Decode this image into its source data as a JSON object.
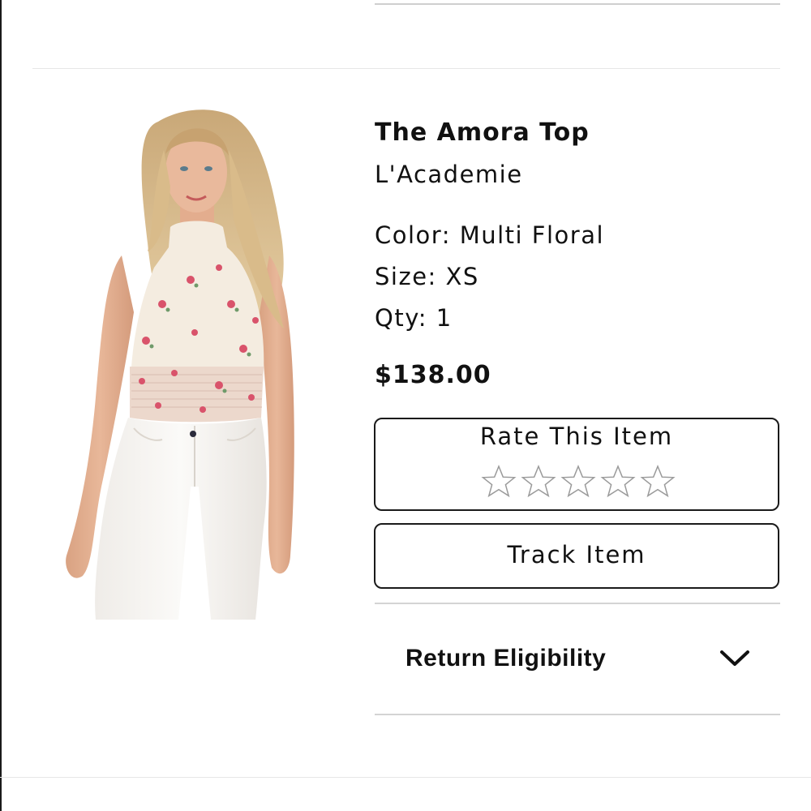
{
  "product": {
    "name": "The Amora Top",
    "brand": "L'Academie",
    "color_label": "Color:",
    "color_value": "Multi Floral",
    "size_label": "Size:",
    "size_value": "XS",
    "qty_label": "Qty:",
    "qty_value": "1",
    "price": "$138.00",
    "image_icon": "product-photo"
  },
  "rating": {
    "label": "Rate This Item",
    "max_stars": 5,
    "current": 0,
    "star_icon": "star-outline-icon"
  },
  "track": {
    "label": "Track Item"
  },
  "return_eligibility": {
    "label": "Return Eligibility",
    "icon": "chevron-down-icon",
    "expanded": false
  },
  "colors": {
    "text": "#111111",
    "border": "#1a1a1a",
    "divider": "#d9d9d9",
    "star_stroke": "#9a9a9a"
  }
}
